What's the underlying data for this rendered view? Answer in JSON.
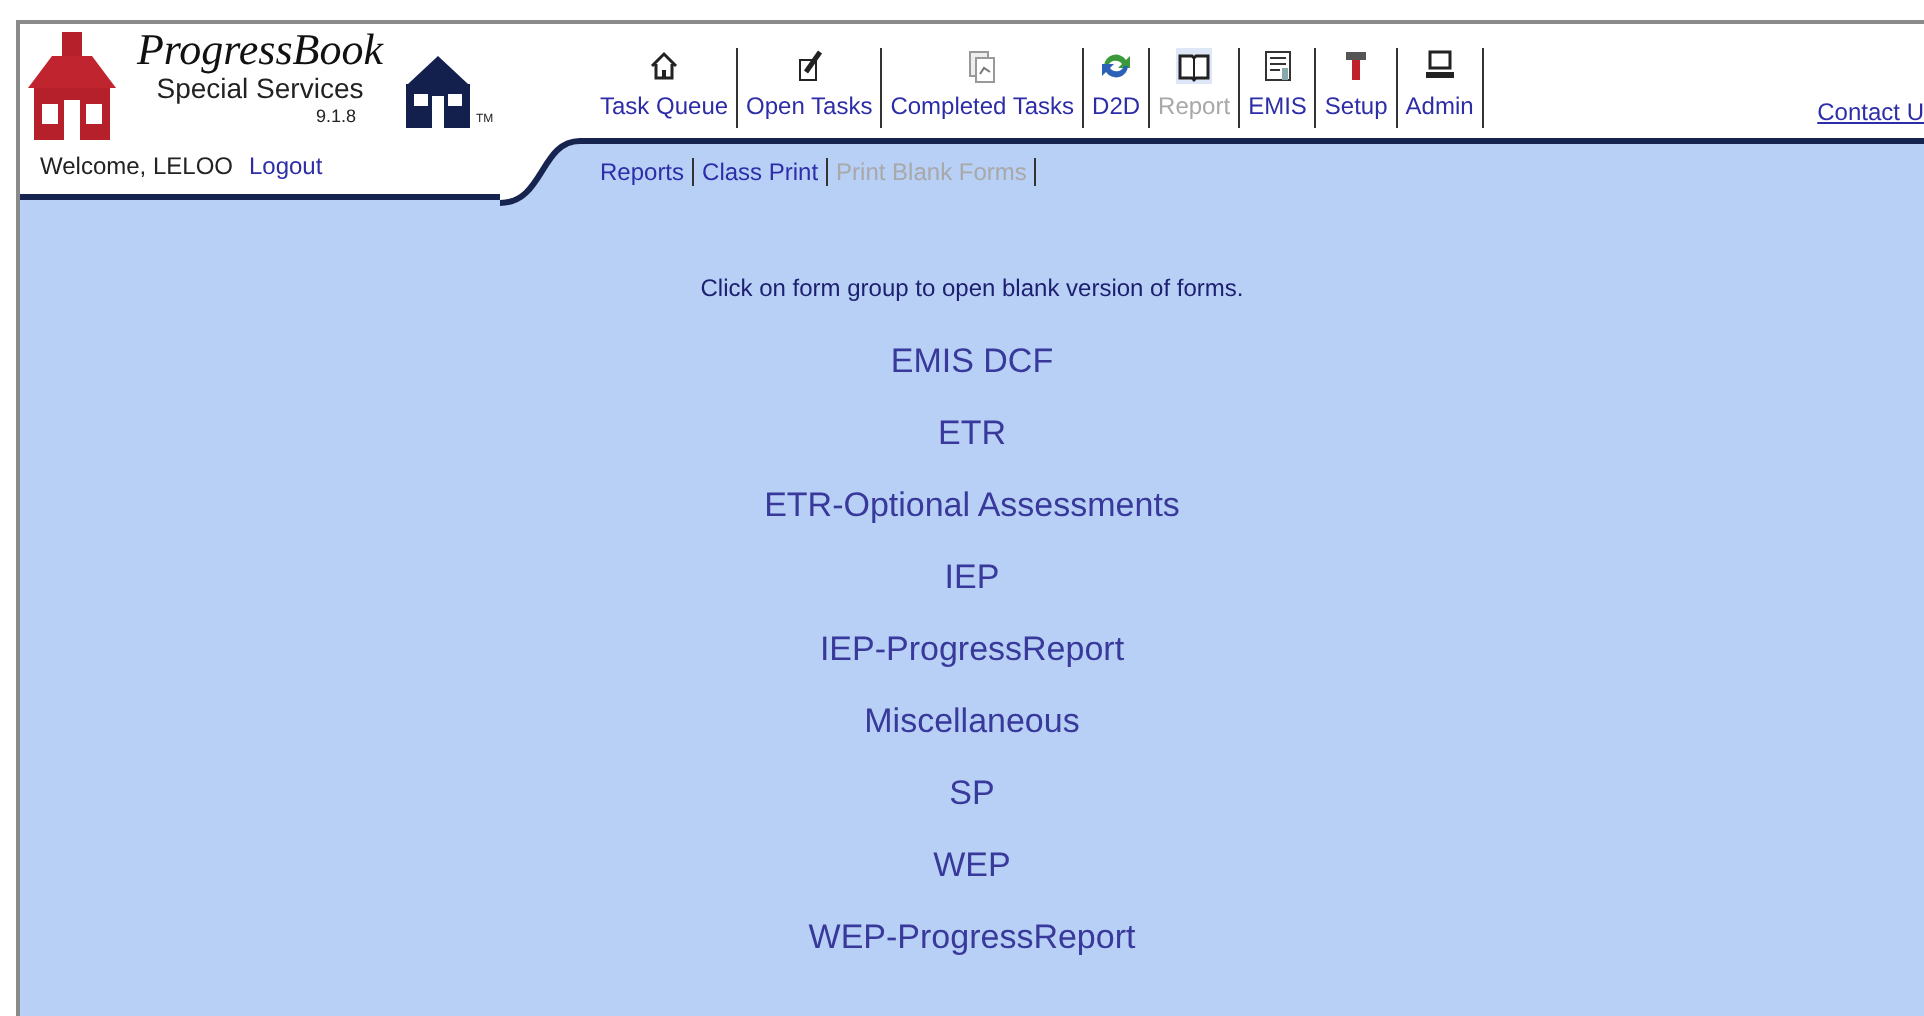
{
  "logo": {
    "brand": "ProgressBook",
    "product": "Special Services",
    "version": "9.1.8",
    "trademark": "TM"
  },
  "welcome": {
    "text": "Welcome, LELOO",
    "logout": "Logout"
  },
  "nav": [
    {
      "label": "Task Queue",
      "selected": false
    },
    {
      "label": "Open Tasks",
      "selected": false
    },
    {
      "label": "Completed Tasks",
      "selected": false
    },
    {
      "label": "D2D",
      "selected": false
    },
    {
      "label": "Report",
      "selected": true
    },
    {
      "label": "EMIS",
      "selected": false
    },
    {
      "label": "Setup",
      "selected": false
    },
    {
      "label": "Admin",
      "selected": false
    }
  ],
  "contact": "Contact U",
  "subnav": [
    {
      "label": "Reports",
      "selected": false
    },
    {
      "label": "Class Print",
      "selected": false
    },
    {
      "label": "Print Blank Forms",
      "selected": true
    }
  ],
  "instruction": "Click on form group to open blank version of forms.",
  "form_groups": [
    "EMIS DCF",
    "ETR",
    "ETR-Optional Assessments",
    "IEP",
    "IEP-ProgressReport",
    "Miscellaneous",
    "SP",
    "WEP",
    "WEP-ProgressReport"
  ]
}
